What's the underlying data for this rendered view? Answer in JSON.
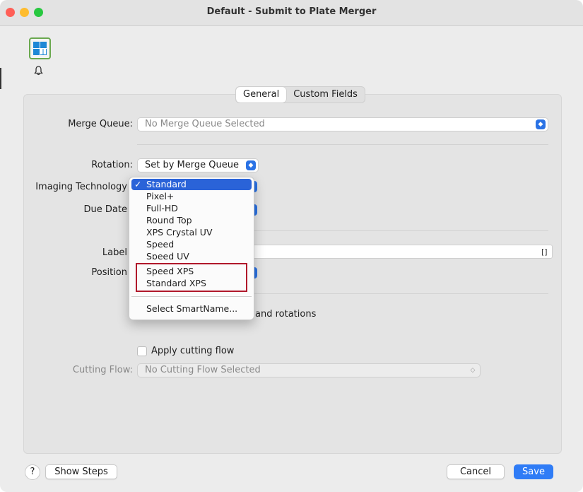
{
  "window": {
    "title": "Default - Submit to Plate Merger"
  },
  "tabs": [
    {
      "label": "General",
      "active": true
    },
    {
      "label": "Custom Fields",
      "active": false
    }
  ],
  "form": {
    "merge_queue_label": "Merge Queue:",
    "merge_queue_value": "No Merge Queue Selected",
    "rotation_label": "Rotation:",
    "rotation_value": "Set by Merge Queue",
    "imaging_technology_label": "Imaging Technology",
    "due_date_label": "Due Date",
    "label_label": "Label",
    "position_label": "Position",
    "allow_rotations_suffix": "and rotations",
    "apply_cutting_flow_label": "Apply cutting flow",
    "cutting_flow_label": "Cutting Flow:",
    "cutting_flow_value": "No Cutting Flow Selected",
    "label_field_icon": "[]"
  },
  "dropdown_menu": {
    "items": [
      {
        "label": "Standard",
        "checked": true
      },
      {
        "label": "Pixel+"
      },
      {
        "label": "Full-HD"
      },
      {
        "label": "Round Top"
      },
      {
        "label": "XPS Crystal UV"
      },
      {
        "label": "Speed"
      },
      {
        "label": "Speed UV"
      },
      {
        "label": "Speed XPS"
      },
      {
        "label": "Standard XPS"
      }
    ],
    "extra_item": "Select SmartName...",
    "check_glyph": "✓"
  },
  "footer": {
    "help_label": "?",
    "show_steps_label": "Show Steps",
    "cancel_label": "Cancel",
    "save_label": "Save"
  },
  "colors": {
    "accent": "#2a72e5",
    "highlight_border": "#b0182b",
    "selected_item": "#2a63d8"
  },
  "icons": [
    "app-logo-icon",
    "bell-icon",
    "chevron-updown-icon",
    "checkmark-icon"
  ]
}
